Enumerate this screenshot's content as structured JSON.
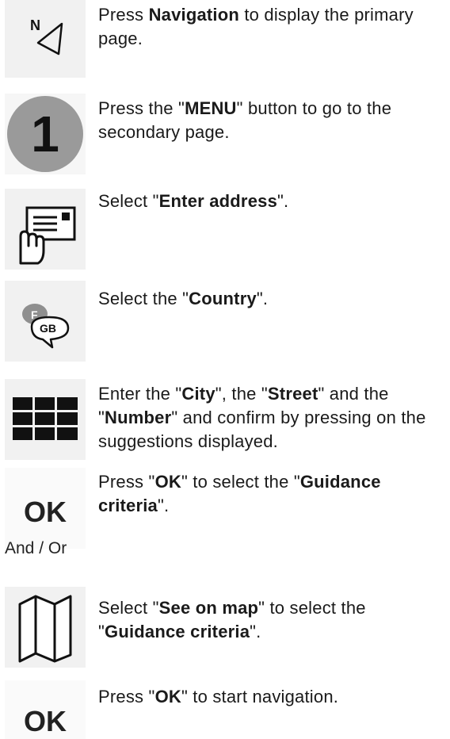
{
  "steps": [
    {
      "id": "navigation",
      "icon": "navigation-arrow-icon",
      "icon_letter": "N",
      "pre1": "Press ",
      "b1": "Navigation",
      "post1": " to display the primary page."
    },
    {
      "id": "menu",
      "icon": "number-one-icon",
      "icon_text": "1",
      "pre1": "Press the \"",
      "b1": "MENU",
      "post1": "\" button to go to the secondary page."
    },
    {
      "id": "enter-address",
      "icon": "address-card-hand-icon",
      "pre1": "Select \"",
      "b1": "Enter address",
      "post1": "\"."
    },
    {
      "id": "country",
      "icon": "country-bubble-icon",
      "icon_text_top": "F",
      "icon_text_main": "GB",
      "pre1": "Select the \"",
      "b1": "Country",
      "post1": "\"."
    },
    {
      "id": "city-street-number",
      "icon": "keypad-grid-icon",
      "pre1": "Enter the \"",
      "b1": "City",
      "mid1": "\", the \"",
      "b2": "Street",
      "mid2": "\" and the \"",
      "b3": "Number",
      "post1": "\" and confirm by pressing on the suggestions displayed."
    },
    {
      "id": "ok-guidance",
      "icon": "ok-icon",
      "icon_text": "OK",
      "pre1": "Press \"",
      "b1": "OK",
      "mid1": "\" to select the \"",
      "b2": "Guidance criteria",
      "post1": "\"."
    },
    {
      "id": "see-on-map",
      "icon": "map-icon",
      "pre1": "Select \"",
      "b1": "See on map",
      "mid1": "\" to select the \"",
      "b2": "Guidance criteria",
      "post1": "\"."
    },
    {
      "id": "ok-start",
      "icon": "ok-icon",
      "icon_text": "OK",
      "pre1": "Press \"",
      "b1": "OK",
      "post1": "\" to start navigation."
    }
  ],
  "and_or": "And / Or"
}
